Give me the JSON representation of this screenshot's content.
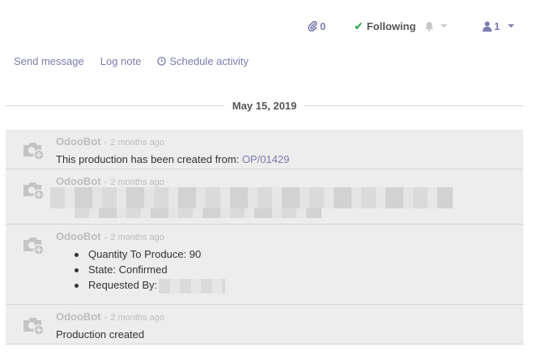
{
  "topbar": {
    "attachments_count": "0",
    "following_label": "Following",
    "followers_count": "1"
  },
  "actions": {
    "send_message": "Send message",
    "log_note": "Log note",
    "schedule_activity": "Schedule activity"
  },
  "date_separator": "May 15, 2019",
  "messages": [
    {
      "author": "OdooBot",
      "separator": "-",
      "time": "2 months ago",
      "text": "This production has been created from:",
      "link": "OP/01429"
    },
    {
      "author": "OdooBot",
      "separator": "-",
      "time": "2 months ago"
    },
    {
      "author": "OdooBot",
      "separator": "-",
      "time": "2 months ago",
      "items": [
        "Quantity To Produce: 90",
        "State: Confirmed",
        "Requested By:"
      ]
    },
    {
      "author": "OdooBot",
      "separator": "-",
      "time": "2 months ago",
      "text": "Production created"
    }
  ],
  "colors": {
    "accent": "#7c7bad",
    "check": "#28a745",
    "message_bg": "#ededed"
  },
  "icons": {
    "attachment": "paperclip-icon",
    "following": "check-icon",
    "bell": "bell-icon",
    "followers": "user-icon",
    "schedule": "clock-icon",
    "avatar": "camera-placeholder-icon"
  }
}
